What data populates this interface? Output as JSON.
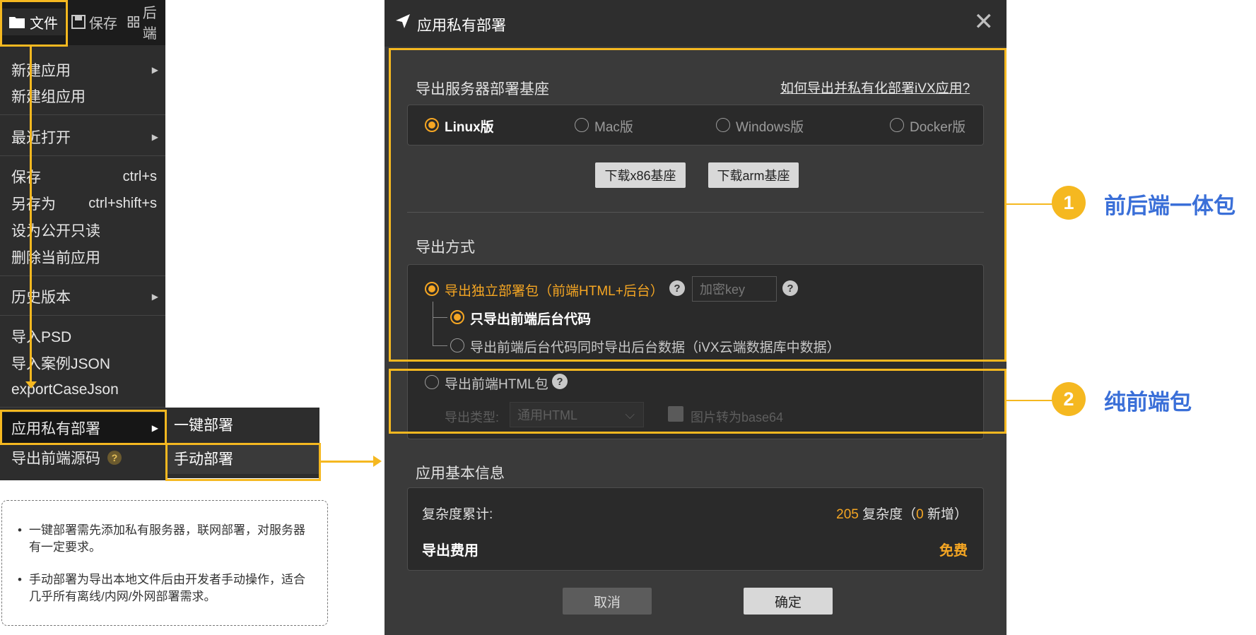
{
  "toolbar": {
    "file_label": "文件",
    "save_label": "保存",
    "backend_label": "后端"
  },
  "menu": {
    "items": [
      {
        "label": "新建应用",
        "has_sub": true
      },
      {
        "label": "新建组应用"
      },
      {
        "label": "最近打开",
        "has_sub": true
      },
      {
        "label": "保存",
        "shortcut": "ctrl+s"
      },
      {
        "label": "另存为",
        "shortcut": "ctrl+shift+s"
      },
      {
        "label": "设为公开只读"
      },
      {
        "label": "删除当前应用"
      },
      {
        "label": "历史版本",
        "has_sub": true
      },
      {
        "label": "导入PSD"
      },
      {
        "label": "导入案例JSON"
      },
      {
        "label": "exportCaseJson"
      },
      {
        "label": "应用私有部署",
        "has_sub": true
      },
      {
        "label": "导出前端源码",
        "help": "?"
      }
    ],
    "submenu": [
      "一键部署",
      "手动部署"
    ]
  },
  "notes": [
    "一键部署需先添加私有服务器，联网部署，对服务器有一定要求。",
    "手动部署为导出本地文件后由开发者手动操作，适合几乎所有离线/内网/外网部署需求。"
  ],
  "dialog": {
    "title": "应用私有部署",
    "close": "✕",
    "base_section": "导出服务器部署基座",
    "help_link": "如何导出并私有化部署iVX应用?",
    "platforms": [
      "Linux版",
      "Mac版",
      "Windows版",
      "Docker版"
    ],
    "selected_platform": "Linux版",
    "download_x86": "下载x86基座",
    "download_arm": "下载arm基座",
    "export_section": "导出方式",
    "option_standalone": "导出独立部署包（前端HTML+后台）",
    "key_placeholder": "加密key",
    "sub_option_code": "只导出前端后台代码",
    "sub_option_data": "导出前端后台代码同时导出后台数据（iVX云端数据库中数据）",
    "option_html": "导出前端HTML包",
    "export_type_label": "导出类型:",
    "export_type_value": "通用HTML",
    "base64_label": "图片转为base64",
    "info_section": "应用基本信息",
    "complexity_label": "复杂度累计:",
    "complexity_value": "205",
    "complexity_text": "复杂度（",
    "complexity_new": "0",
    "complexity_suffix": "新增）",
    "fee_label": "导出费用",
    "fee_value": "免费",
    "cancel": "取消",
    "confirm": "确定"
  },
  "callouts": [
    {
      "number": "1",
      "text": "前后端一体包"
    },
    {
      "number": "2",
      "text": "纯前端包"
    }
  ],
  "colors": {
    "accent": "#f5b820",
    "orange": "#f5a623",
    "callout_text": "#3a6fd8"
  }
}
